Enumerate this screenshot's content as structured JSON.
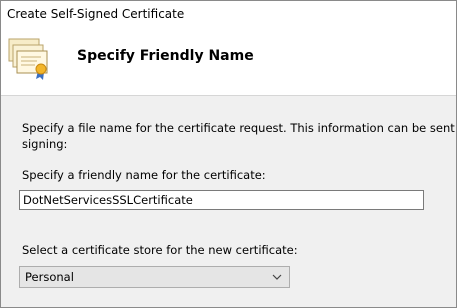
{
  "window": {
    "title": "Create Self-Signed Certificate"
  },
  "header": {
    "title": "Specify Friendly Name",
    "icon": "certificate-icon"
  },
  "main": {
    "description_line1": "Specify a file name for the certificate request.  This information can be sent to a certificate authority for",
    "description_line2": "signing:",
    "friendly_name_label": "Specify a friendly name for the certificate:",
    "friendly_name_value": "DotNetServicesSSLCertificate",
    "store_label": "Select a certificate store for the new certificate:",
    "store_value": "Personal"
  }
}
